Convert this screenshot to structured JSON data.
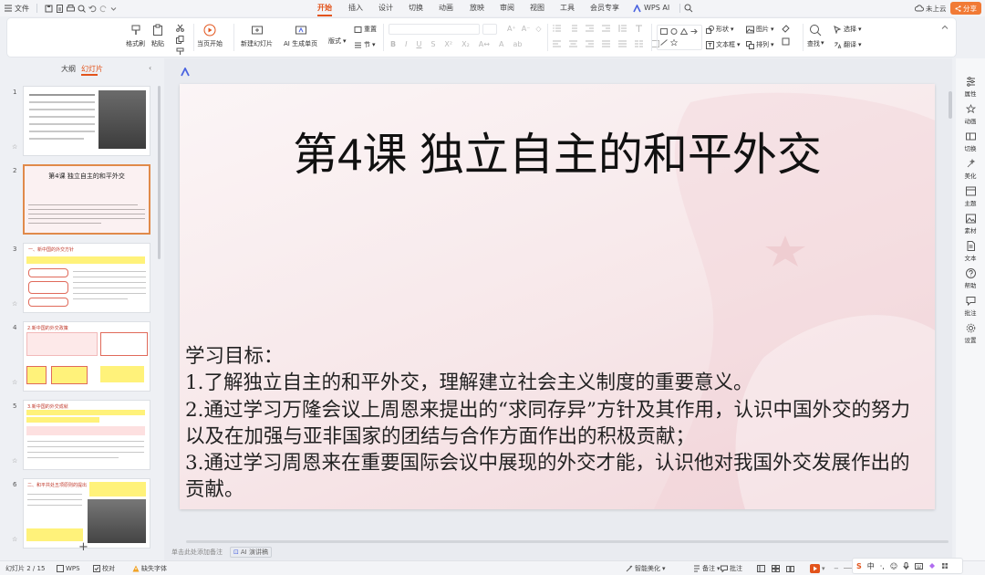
{
  "menubar": {
    "file_label": "文件",
    "tabs": [
      {
        "label": "开始",
        "active": true
      },
      {
        "label": "插入"
      },
      {
        "label": "设计"
      },
      {
        "label": "切换"
      },
      {
        "label": "动画"
      },
      {
        "label": "放映"
      },
      {
        "label": "审阅"
      },
      {
        "label": "视图"
      },
      {
        "label": "工具"
      },
      {
        "label": "会员专享"
      },
      {
        "label": "WPS AI"
      }
    ],
    "cloud_label": "未上云",
    "share_label": "分享",
    "accent": "#e2531b"
  },
  "ribbon": {
    "format_painter": "格式刷",
    "paste": "粘贴",
    "play_from_current": "当页开始",
    "new_slide": "新建幻灯片",
    "ai_generate": "AI 生成单页",
    "layout": "版式",
    "section": "节",
    "reset": "重置",
    "shape": "形状",
    "picture": "图片",
    "textbox": "文本框",
    "arrange": "排列",
    "find": "查找",
    "select": "选择",
    "replace": "翻译"
  },
  "left_panel": {
    "tab_outline": "大纲",
    "tab_slides": "幻灯片",
    "thumb2_title": "第4课 独立自主的和平外交",
    "thumb3_heading": "一、新中国的外交方针",
    "thumb4_heading": "2.新中国的外交政策",
    "thumb5_heading": "3.新中国的外交成就",
    "thumb6_heading": "二、和平共处五项原则的提出",
    "slide_numbers": [
      "1",
      "2",
      "3",
      "4",
      "5",
      "6"
    ]
  },
  "slide": {
    "title": "第4课  独立自主的和平外交",
    "body_heading": "学习目标：",
    "body_lines": [
      "1.了解独立自主的和平外交，理解建立社会主义制度的重要意义。",
      "2.通过学习万隆会议上周恩来提出的“求同存异”方针及其作用，认识中国外交的努力以及在加强与亚非国家的团结与合作方面作出的积极贡献；",
      "3.通过学习周恩来在重要国际会议中展现的外交才能，认识他对我国外交发展作出的贡献。"
    ]
  },
  "notes_placeholder": "单击此处添加备注",
  "ai_notes_label": "AI 演讲稿",
  "right_rail": [
    "属性",
    "动画",
    "切换",
    "美化",
    "主题",
    "素材",
    "文本",
    "帮助",
    "批注",
    "设置"
  ],
  "status": {
    "slide_counter": "幻灯片 2 / 15",
    "theme": "WPS",
    "proofread": "校对",
    "missing_font": "缺失字体",
    "smart_beautify": "智能美化",
    "notes": "备注",
    "comments": "批注",
    "zoom_percent": "44%"
  }
}
